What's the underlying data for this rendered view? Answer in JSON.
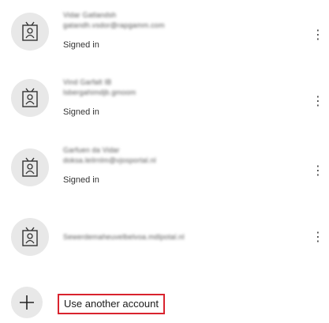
{
  "accounts": [
    {
      "name": "Vidar Gatlandsh",
      "email": "gatandh.vsdor@rapgamm.com",
      "status": "Signed in"
    },
    {
      "name": "Vind Garfalt IB",
      "email": "lsbergahimdjb.gmoom",
      "status": "Signed in"
    },
    {
      "name": "Garfuen da Vidar",
      "email": "doksa.leilrnlm@vjosportal.nl",
      "status": "Signed in"
    },
    {
      "name": "",
      "email": "Sewerdemaheuvelbelvoa.mdlpotal.nl",
      "status": ""
    }
  ],
  "more_options_glyph": "⋮",
  "add_account": {
    "label": "Use another account",
    "icon": "plus-icon"
  },
  "avatar_icon": "badge-icon",
  "colors": {
    "highlight_border": "#d9232e",
    "avatar_bg": "#e8e8e8"
  }
}
